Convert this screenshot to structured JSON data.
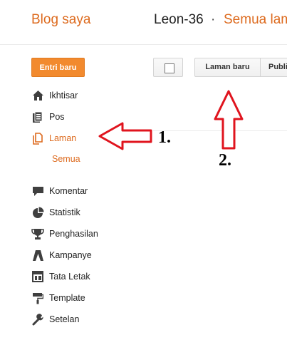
{
  "header": {
    "brand": "Blog saya",
    "blog_name": "Leon-36",
    "separator": "·",
    "crumb": "Semua laman"
  },
  "toolbar": {
    "new_post_label": "Entri baru",
    "new_page_label": "Laman baru",
    "publish_label": "Publikasikan"
  },
  "sidebar": {
    "items": [
      {
        "label": "Ikhtisar",
        "icon": "home-icon"
      },
      {
        "label": "Pos",
        "icon": "posts-icon"
      },
      {
        "label": "Laman",
        "icon": "pages-icon",
        "active": true
      },
      {
        "label": "Komentar",
        "icon": "comment-icon"
      },
      {
        "label": "Statistik",
        "icon": "pie-chart-icon"
      },
      {
        "label": "Penghasilan",
        "icon": "trophy-icon"
      },
      {
        "label": "Kampanye",
        "icon": "campaign-icon"
      },
      {
        "label": "Tata Letak",
        "icon": "layout-icon"
      },
      {
        "label": "Template",
        "icon": "paint-roller-icon"
      },
      {
        "label": "Setelan",
        "icon": "wrench-icon"
      }
    ],
    "sub_items": [
      "Semua"
    ]
  },
  "annotations": {
    "label_1": "1.",
    "label_2": "2."
  },
  "colors": {
    "accent": "#dd6b1f",
    "button_orange": "#f28a2e",
    "annotation_red": "#e0141e"
  }
}
